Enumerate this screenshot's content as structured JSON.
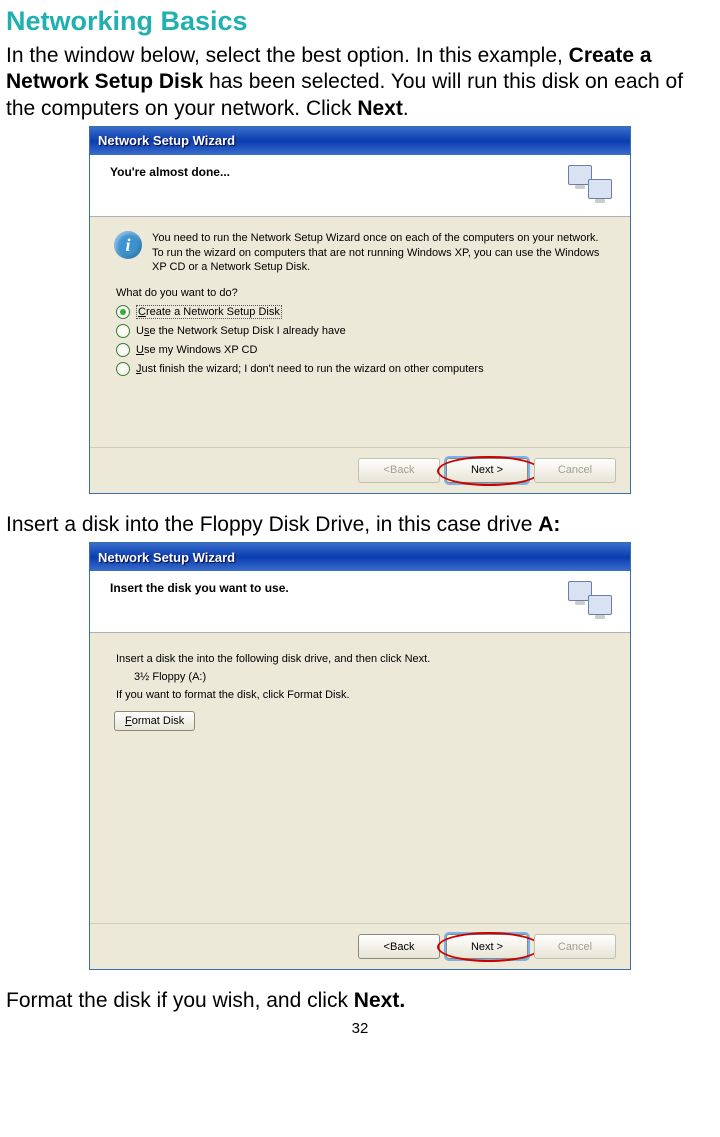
{
  "heading": "Networking Basics",
  "intro_1a": "In the window below, select the best option.  In this example, ",
  "intro_1b": "Create a Network Setup Disk",
  "intro_1c": " has been selected.  You will run this disk on each of the computers on your network.  Click ",
  "intro_1d": "Next",
  "intro_1e": ".",
  "dialog1": {
    "title": "Network Setup Wizard",
    "header": "You're almost done...",
    "info": "You need to run the Network Setup Wizard once on each of the computers on your network. To run the wizard on computers that are not running Windows XP, you can use the Windows XP CD or a Network Setup Disk.",
    "prompt": "What do you want to do?",
    "opt1_pre": "",
    "opt1_u": "C",
    "opt1_post": "reate a Network Setup Disk",
    "opt2_pre": "U",
    "opt2_u": "s",
    "opt2_post": "e the Network Setup Disk I already have",
    "opt3_pre": "",
    "opt3_u": "U",
    "opt3_post": "se my Windows XP CD",
    "opt4_pre": "",
    "opt4_u": "J",
    "opt4_post": "ust finish the wizard; I don't need to run the wizard on other computers",
    "back_pre": "< ",
    "back_u": "B",
    "back_post": "ack",
    "next_u": "N",
    "next_post": "ext >",
    "cancel": "Cancel"
  },
  "mid_1a": "Insert a disk into the Floppy Disk Drive, in this case drive ",
  "mid_1b": "A:",
  "dialog2": {
    "title": "Network Setup Wizard",
    "header": "Insert the disk you want to use.",
    "line1": "Insert a disk the into the following disk drive, and then click Next.",
    "drive": "3½ Floppy (A:)",
    "line2": "If you want to format the disk, click Format Disk.",
    "format_u": "F",
    "format_post": "ormat Disk",
    "back_pre": "< ",
    "back_u": "B",
    "back_post": "ack",
    "next_u": "N",
    "next_post": "ext >",
    "cancel": "Cancel"
  },
  "foot_1a": "Format the disk if you wish, and click ",
  "foot_1b": "Next.",
  "page_number": "32"
}
